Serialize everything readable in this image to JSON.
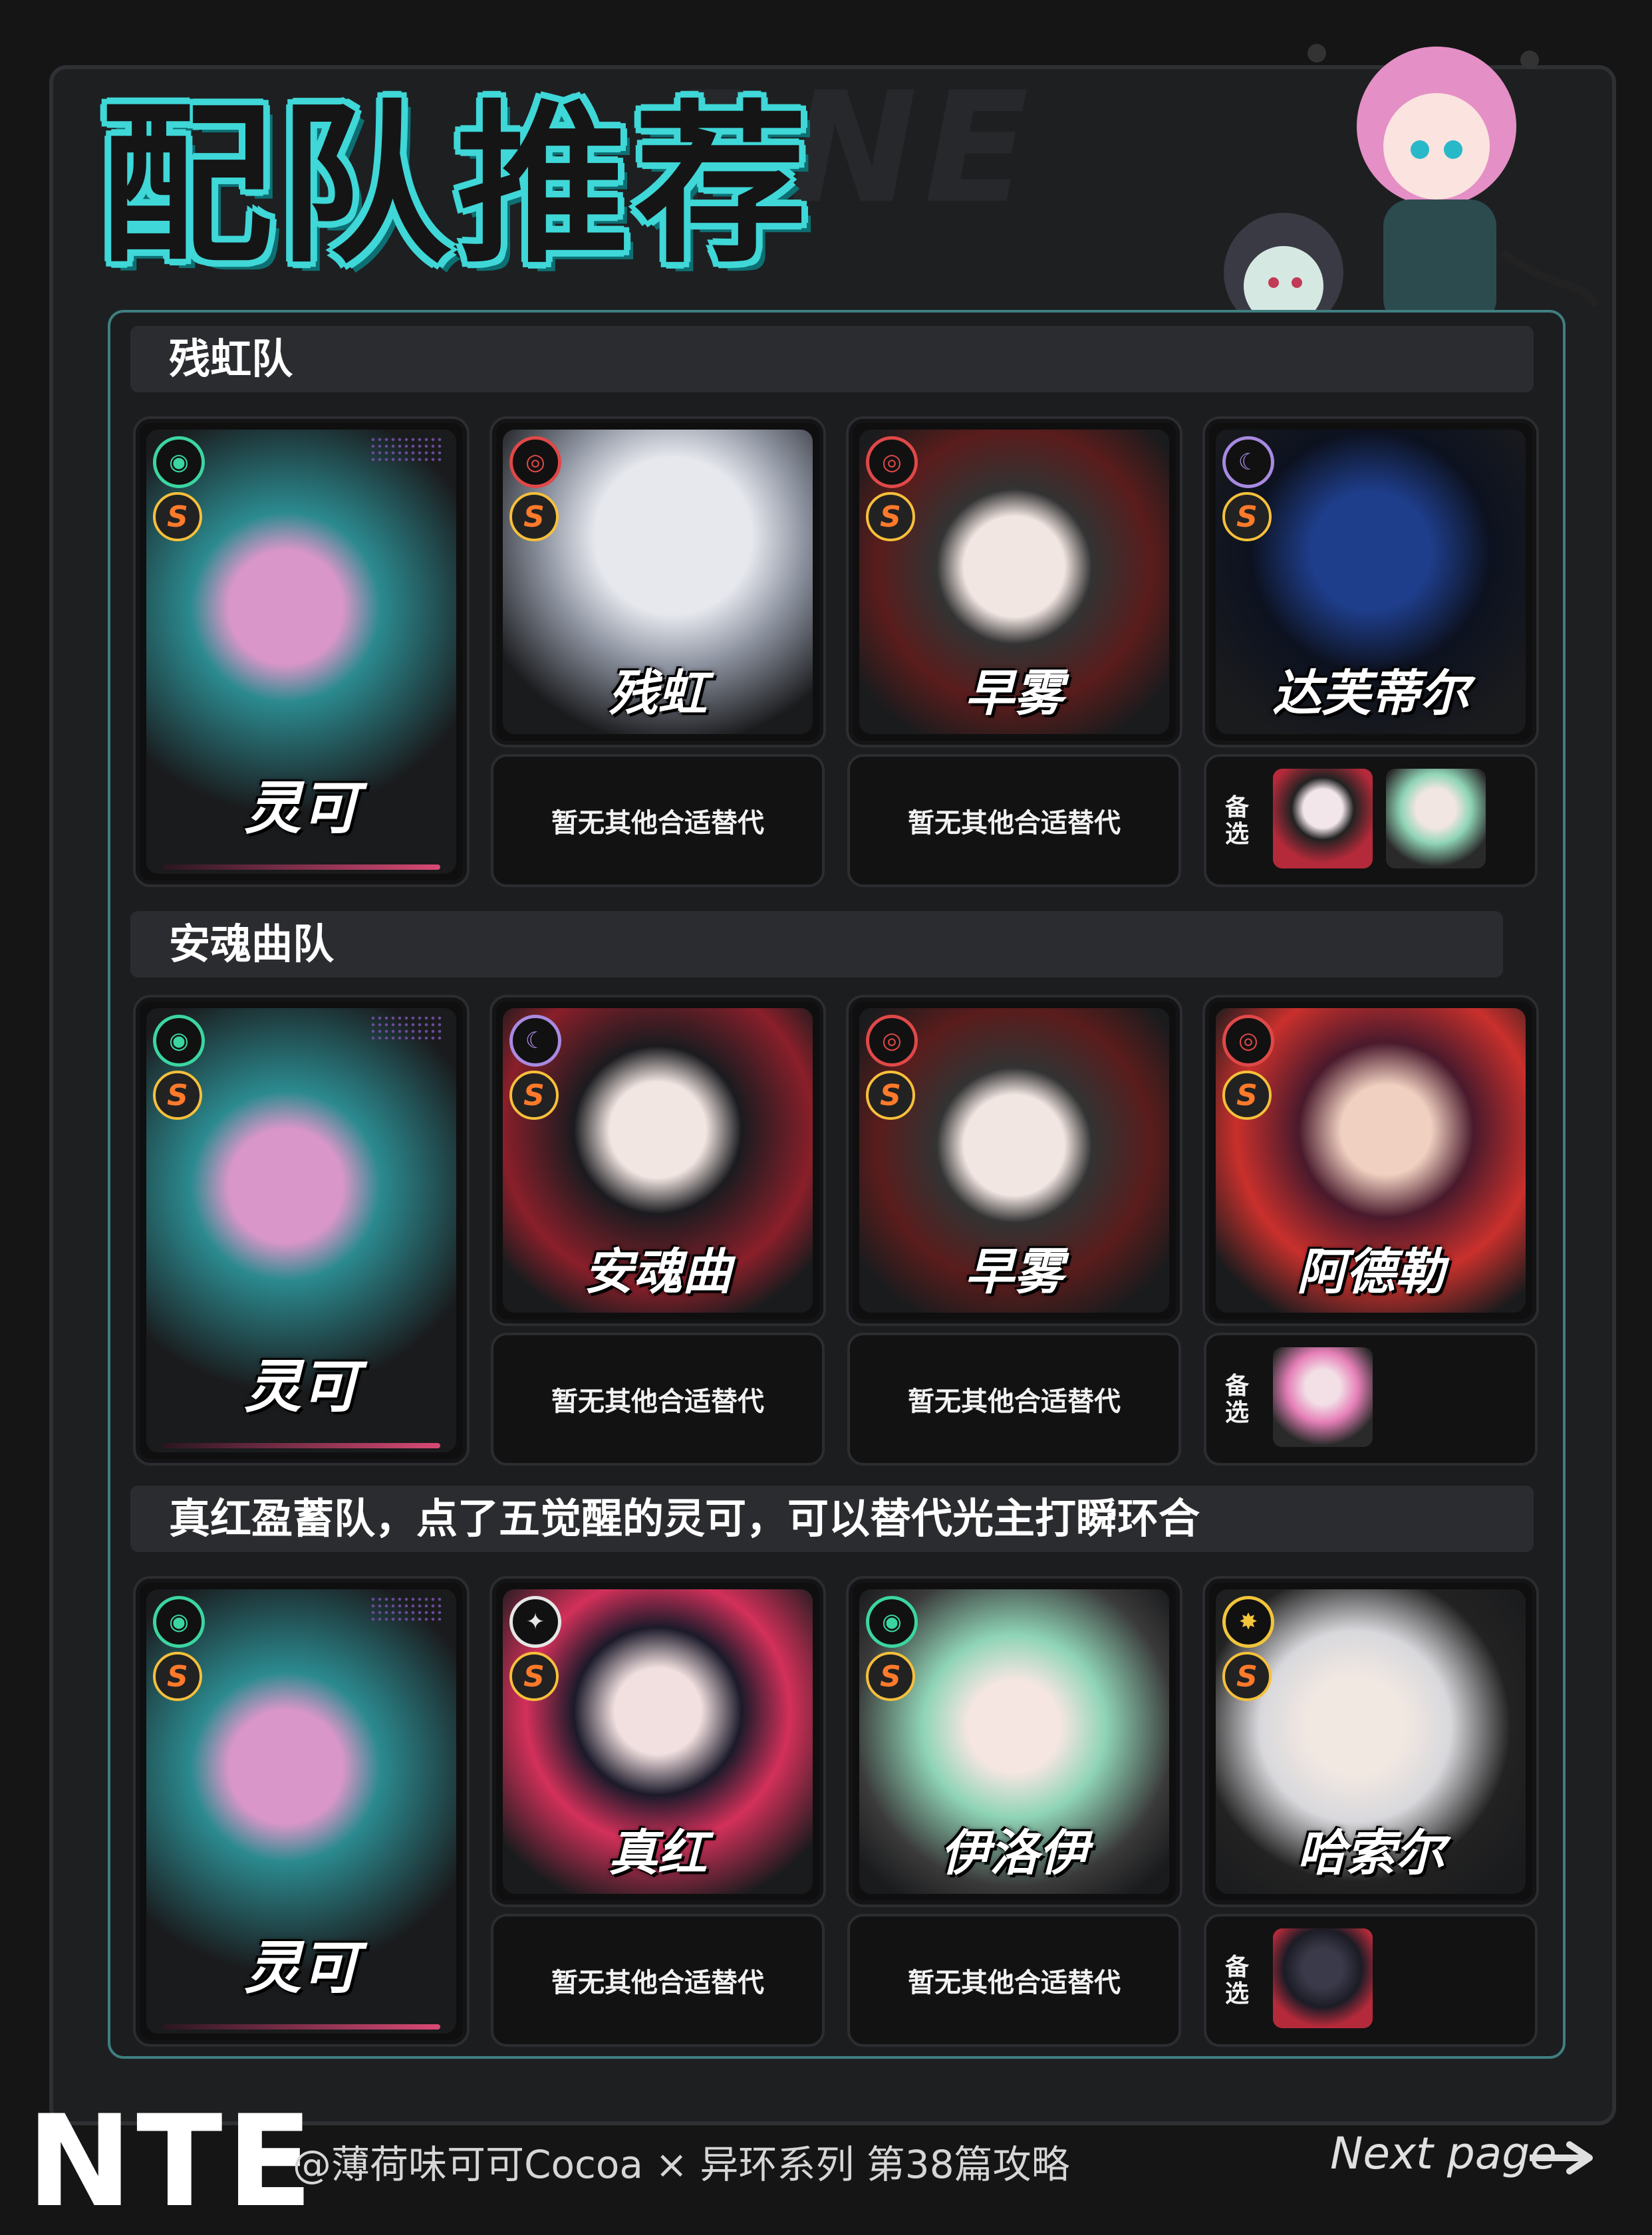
{
  "title": "配队推荐",
  "sections": [
    {
      "header": "残虹队",
      "lead": {
        "name": "灵可",
        "element": "anomaly-icon"
      },
      "members": [
        {
          "name": "残虹",
          "element": "target-icon",
          "alt": "暂无其他合适替代"
        },
        {
          "name": "早雾",
          "element": "target-icon",
          "alt": "暂无其他合适替代"
        },
        {
          "name": "达芙蒂尔",
          "element": "moon-icon",
          "alt_label": "备选"
        }
      ]
    },
    {
      "header": "安魂曲队",
      "lead": {
        "name": "灵可",
        "element": "anomaly-icon"
      },
      "members": [
        {
          "name": "安魂曲",
          "element": "moon-icon",
          "alt": "暂无其他合适替代"
        },
        {
          "name": "早雾",
          "element": "target-icon",
          "alt": "暂无其他合适替代"
        },
        {
          "name": "阿德勒",
          "element": "target-icon",
          "alt_label": "备选"
        }
      ]
    },
    {
      "header": "真红盈蓄队，点了五觉醒的灵可，可以替代光主打瞬环合",
      "lead": {
        "name": "灵可",
        "element": "anomaly-icon"
      },
      "members": [
        {
          "name": "真红",
          "element": "star-icon",
          "alt": "暂无其他合适替代"
        },
        {
          "name": "伊洛伊",
          "element": "anomaly-icon",
          "alt": "暂无其他合适替代"
        },
        {
          "name": "哈索尔",
          "element": "sun-icon",
          "alt_label": "备选"
        }
      ]
    }
  ],
  "rank_label": "S",
  "footer": {
    "logo": "NTE",
    "credit": "@薄荷味可可Cocoa × 异环系列 第38篇攻略",
    "next": "Next page"
  },
  "colors": {
    "accent": "#3fd7d7",
    "rank": "#f7c03a",
    "pink": "#d94a76"
  }
}
